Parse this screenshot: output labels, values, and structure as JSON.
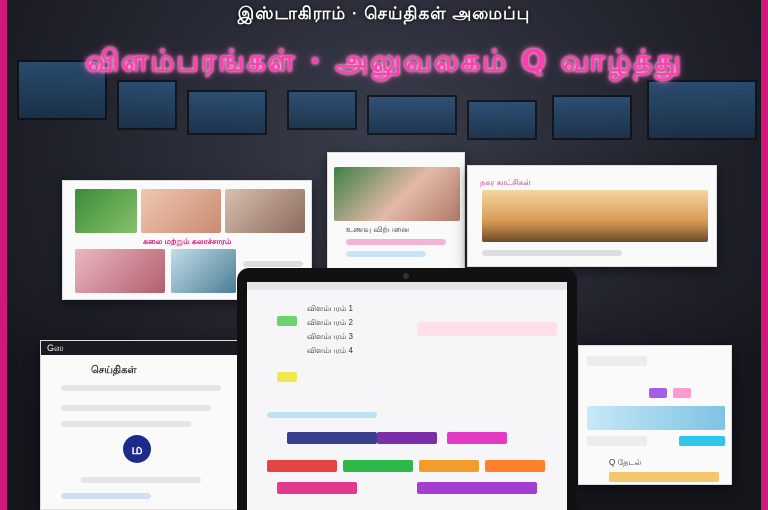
{
  "headline": "இஸ்டாகிராம் · செய்திகள் அமைப்பு",
  "title": "விளம்பரங்கள் · அலுவலகம் Q வாழ்த்து",
  "colors": {
    "accent": "#d0177a",
    "title": "#ff3fb0",
    "avatar": "#1c2a8a"
  },
  "left_panel": {
    "brand": "Gஸ",
    "heading": "செய்திகள்",
    "avatar_letter": "ம"
  },
  "cards": {
    "left": {
      "caption": "கலை மற்றும் கலாச்சாரம்"
    },
    "center": {
      "caption": "உணவு விற்பனை"
    },
    "right": {
      "caption": "நகர காட்சிகள்"
    }
  },
  "laptop": {
    "rows": [
      "விளம்பரம் 1",
      "விளம்பரம் 2",
      "விளம்பரம் 3",
      "விளம்பரம் 4"
    ]
  },
  "right_panel": {
    "label": "Q தேடல்"
  }
}
